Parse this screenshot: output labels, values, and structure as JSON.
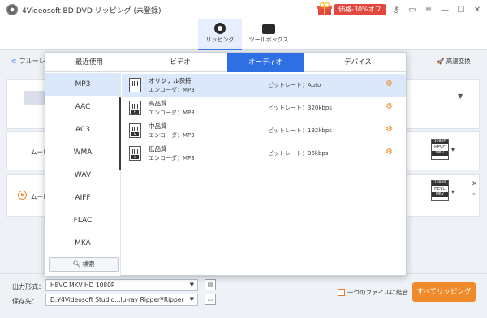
{
  "app": {
    "title": "4Videosoft BD-DVD リッピング (未登録)",
    "promo": "価格-30%オフ"
  },
  "titlebar_icons": [
    "key-icon",
    "chat-icon",
    "menu-icon",
    "minimize-icon",
    "maximize-icon",
    "close-icon"
  ],
  "nav": {
    "ripping": "リッピング",
    "toolbox": "ツールボックス"
  },
  "main": {
    "bluray_label": "ブルーレ",
    "hw_accel": "高速変換",
    "movie1": "ムービ",
    "movie2": "ムービ",
    "format_badge": {
      "top": "1080P",
      "mid": "HEVC",
      "bottom": "MKV"
    }
  },
  "dropdown": {
    "tabs": [
      "最近使用",
      "ビデオ",
      "オーディオ",
      "デバイス"
    ],
    "active_tab": 2,
    "formats": [
      "MP3",
      "AAC",
      "AC3",
      "WMA",
      "WAV",
      "AIFF",
      "FLAC",
      "MKA"
    ],
    "search_label": "検索",
    "presets": [
      {
        "name": "オリジナル保持",
        "encoder": "エンコーダ：MP3",
        "bitrate": "ビットレート：Auto",
        "tag": ""
      },
      {
        "name": "高品質",
        "encoder": "エンコーダ：MP3",
        "bitrate": "ビットレート：320kbps",
        "tag": "H"
      },
      {
        "name": "中品質",
        "encoder": "エンコーダ：MP3",
        "bitrate": "ビットレート：192kbps",
        "tag": "M"
      },
      {
        "name": "低品質",
        "encoder": "エンコーダ：MP3",
        "bitrate": "ビットレート：96kbps",
        "tag": "L"
      }
    ]
  },
  "bottom": {
    "output_format_label": "出力形式：",
    "output_format_value": "HEVC MKV HD 1080P",
    "save_to_label": "保存先：",
    "save_to_value": "D:¥4Videosoft Studio…lu-ray Ripper¥Ripper",
    "merge_label": "一つのファイルに結合",
    "rip_all": "すべてリッピング"
  },
  "colors": {
    "accent": "#2f6fe4",
    "orange": "#f08b2b",
    "promo": "#e2483d"
  }
}
